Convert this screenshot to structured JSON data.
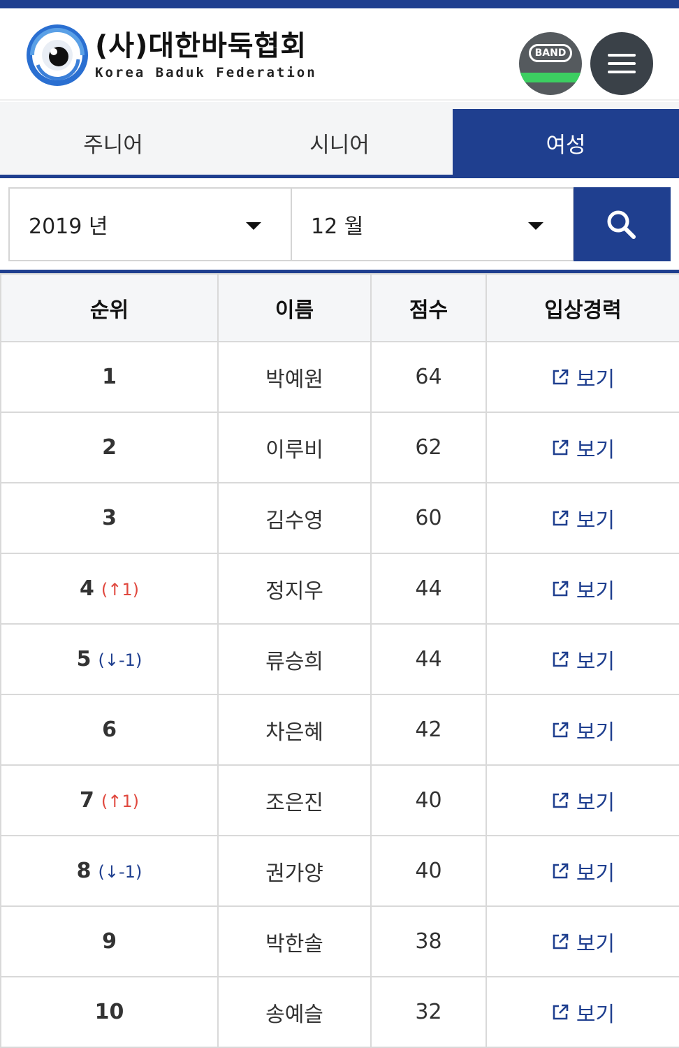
{
  "header": {
    "org_name_kor": "(사)대한바둑협회",
    "org_name_eng": "Korea Baduk Federation",
    "band_label": "BAND",
    "icons": {
      "logo": "go-stone-swirl-logo",
      "band": "band-app-icon",
      "menu": "hamburger-menu-icon"
    }
  },
  "tabs": [
    {
      "label": "주니어",
      "active": false
    },
    {
      "label": "시니어",
      "active": false
    },
    {
      "label": "여성",
      "active": true
    }
  ],
  "filters": {
    "year": "2019 년",
    "month": "12 월",
    "search_icon": "search-icon"
  },
  "table": {
    "headers": [
      "순위",
      "이름",
      "점수",
      "입상경력"
    ],
    "rows": [
      {
        "rank": "1",
        "change": "",
        "change_dir": "",
        "name": "박예원",
        "score": "64",
        "link": "보기"
      },
      {
        "rank": "2",
        "change": "",
        "change_dir": "",
        "name": "이루비",
        "score": "62",
        "link": "보기"
      },
      {
        "rank": "3",
        "change": "",
        "change_dir": "",
        "name": "김수영",
        "score": "60",
        "link": "보기"
      },
      {
        "rank": "4",
        "change": "1",
        "change_dir": "up",
        "name": "정지우",
        "score": "44",
        "link": "보기"
      },
      {
        "rank": "5",
        "change": "-1",
        "change_dir": "down",
        "name": "류승희",
        "score": "44",
        "link": "보기"
      },
      {
        "rank": "6",
        "change": "",
        "change_dir": "",
        "name": "차은혜",
        "score": "42",
        "link": "보기"
      },
      {
        "rank": "7",
        "change": "1",
        "change_dir": "up",
        "name": "조은진",
        "score": "40",
        "link": "보기"
      },
      {
        "rank": "8",
        "change": "-1",
        "change_dir": "down",
        "name": "권가양",
        "score": "40",
        "link": "보기"
      },
      {
        "rank": "9",
        "change": "",
        "change_dir": "",
        "name": "박한솔",
        "score": "38",
        "link": "보기"
      },
      {
        "rank": "10",
        "change": "",
        "change_dir": "",
        "name": "송예슬",
        "score": "32",
        "link": "보기"
      }
    ]
  },
  "colors": {
    "brand": "#1f3f8f",
    "rank_up": "#e0483e",
    "rank_down": "#1f3f8f",
    "band_green": "#3ccf61"
  }
}
